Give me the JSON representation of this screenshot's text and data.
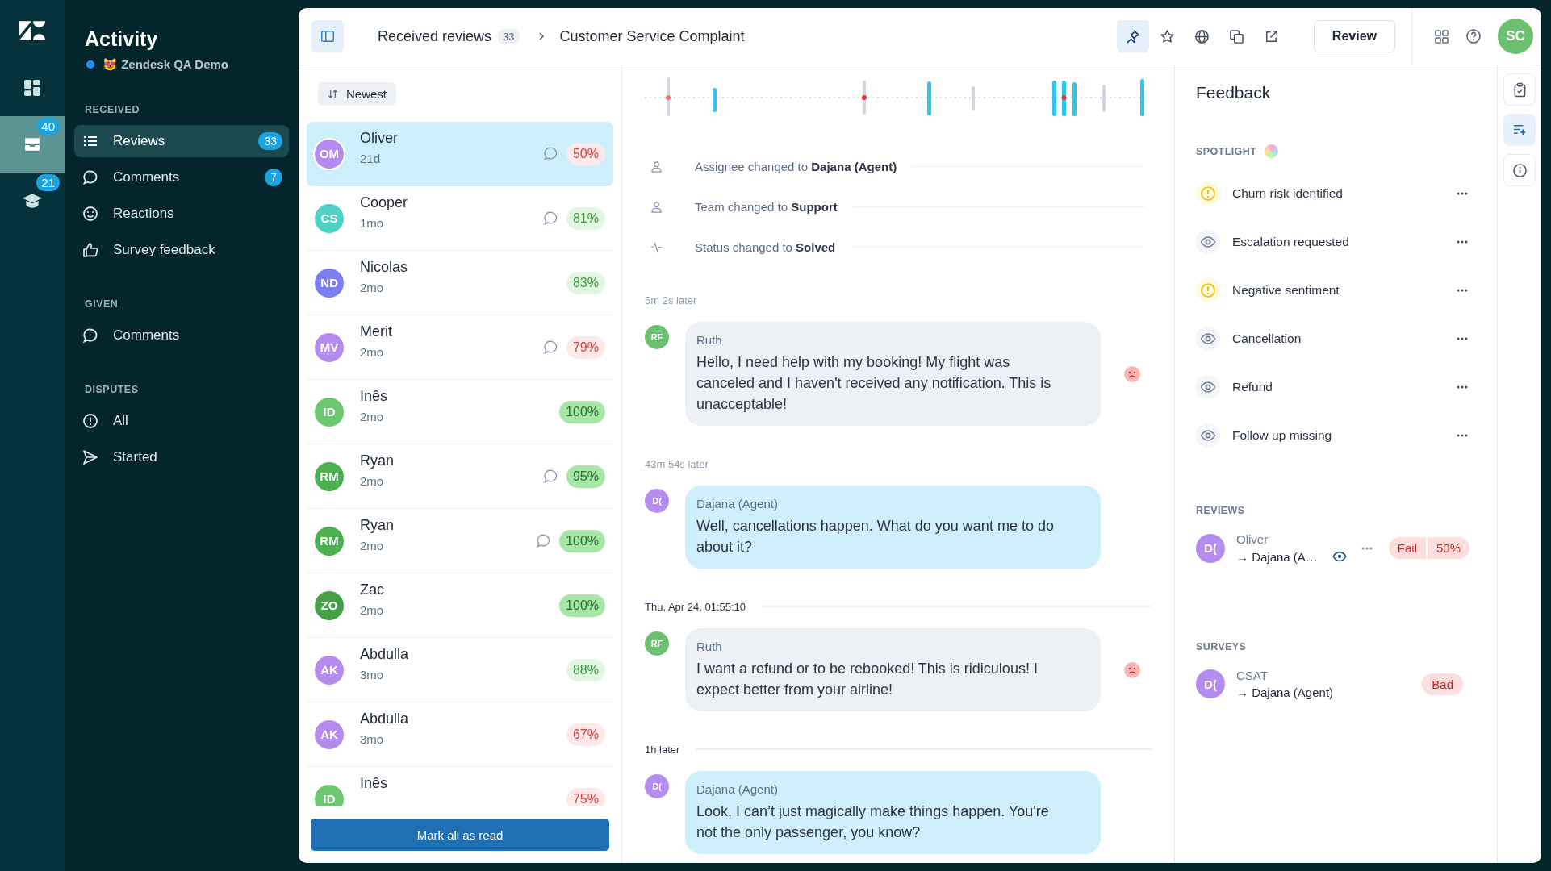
{
  "rail": [
    {
      "kind": "dashboard",
      "selected": false
    },
    {
      "kind": "inbox",
      "selected": true,
      "badge": "40"
    },
    {
      "kind": "cap",
      "selected": false,
      "badge": "21"
    }
  ],
  "sidebar": {
    "title": "Activity",
    "workspace": "😻 Zendesk QA Demo",
    "sections": [
      {
        "heading": "RECEIVED",
        "items": [
          {
            "kind": "list",
            "label": "Reviews",
            "count": "33",
            "selected": true
          },
          {
            "kind": "comment",
            "label": "Comments",
            "count": "7",
            "selected": false
          },
          {
            "kind": "smile",
            "label": "Reactions",
            "selected": false
          },
          {
            "kind": "thumb",
            "label": "Survey feedback",
            "selected": false
          }
        ]
      },
      {
        "heading": "GIVEN",
        "items": [
          {
            "kind": "comment",
            "label": "Comments",
            "selected": false
          }
        ]
      },
      {
        "heading": "DISPUTES",
        "items": [
          {
            "kind": "alert",
            "label": "All",
            "selected": false
          },
          {
            "kind": "send",
            "label": "Started",
            "selected": false
          }
        ]
      }
    ]
  },
  "header": {
    "crumb": "Received reviews",
    "crumb_count": "33",
    "title": "Customer Service Complaint",
    "actions": [
      {
        "kind": "pin",
        "selected": true
      },
      {
        "kind": "star",
        "selected": false
      },
      {
        "kind": "globe",
        "selected": false
      },
      {
        "kind": "copy",
        "selected": false
      },
      {
        "kind": "external",
        "selected": false
      }
    ],
    "review_button": "Review",
    "user_initials": "SC"
  },
  "list": {
    "sort": "Newest",
    "mark_button": "Mark all as read",
    "items": [
      {
        "initials": "OM",
        "color": "#b48cf0",
        "name": "Oliver",
        "time": "21d",
        "comment": true,
        "score": "50%",
        "passed": false,
        "top": false,
        "selected": true
      },
      {
        "initials": "CS",
        "color": "#4fd1c5",
        "name": "Cooper",
        "time": "1mo",
        "comment": true,
        "score": "81%",
        "passed": true,
        "top": false,
        "selected": false
      },
      {
        "initials": "ND",
        "color": "#7a7ef0",
        "name": "Nicolas",
        "time": "2mo",
        "comment": false,
        "score": "83%",
        "passed": true,
        "top": false,
        "selected": false
      },
      {
        "initials": "MV",
        "color": "#b48cf0",
        "name": "Merit",
        "time": "2mo",
        "comment": true,
        "score": "79%",
        "passed": false,
        "top": false,
        "selected": false
      },
      {
        "initials": "ID",
        "color": "#6cc870",
        "name": "Inês",
        "time": "2mo",
        "comment": false,
        "score": "100%",
        "passed": true,
        "top": true,
        "selected": false
      },
      {
        "initials": "RM",
        "color": "#4caf50",
        "name": "Ryan",
        "time": "2mo",
        "comment": true,
        "score": "95%",
        "passed": true,
        "top": true,
        "selected": false
      },
      {
        "initials": "RM",
        "color": "#4caf50",
        "name": "Ryan",
        "time": "2mo",
        "comment": true,
        "score": "100%",
        "passed": true,
        "top": true,
        "selected": false
      },
      {
        "initials": "ZO",
        "color": "#43a047",
        "name": "Zac",
        "time": "2mo",
        "comment": false,
        "score": "100%",
        "passed": true,
        "top": true,
        "selected": false
      },
      {
        "initials": "AK",
        "color": "#b48cf0",
        "name": "Abdulla",
        "time": "3mo",
        "comment": false,
        "score": "88%",
        "passed": true,
        "top": false,
        "selected": false
      },
      {
        "initials": "AK",
        "color": "#b48cf0",
        "name": "Abdulla",
        "time": "3mo",
        "comment": false,
        "score": "67%",
        "passed": false,
        "top": false,
        "selected": false
      },
      {
        "initials": "ID",
        "color": "#6cc870",
        "name": "Inês",
        "comment": false,
        "score": "75%",
        "passed": false,
        "top": false,
        "selected": false
      }
    ]
  },
  "events": [
    {
      "kind": "person",
      "text": "Assignee changed to **Dajana (Agent)**"
    },
    {
      "kind": "person",
      "text": "Team changed to **Support**"
    },
    {
      "kind": "activity",
      "text": "Status changed to **Solved**"
    }
  ],
  "thread": [
    {
      "kind": "gap",
      "label": "5m 2s later",
      "ruled": false
    },
    {
      "kind": "message",
      "from_agent": false,
      "initials": "RF",
      "color": "#6cc070",
      "author": "Ruth",
      "text": "Hello, I need help with my booking! My flight was canceled and I haven't received any notification. This is unacceptable!",
      "negative": true
    },
    {
      "kind": "gap",
      "label": "43m 54s later",
      "ruled": false
    },
    {
      "kind": "message",
      "from_agent": true,
      "initials": "D(",
      "color": "#b58cf0",
      "author": "Dajana (Agent)",
      "text": "Well, cancellations happen. What do you want me to do about it?",
      "negative": false
    },
    {
      "kind": "gap",
      "label": "Thu, Apr 24, 01:55:10",
      "ruled": true
    },
    {
      "kind": "message",
      "from_agent": false,
      "initials": "RF",
      "color": "#6cc070",
      "author": "Ruth",
      "text": "I want a refund or to be rebooked! This is ridiculous! I expect better from your airline!",
      "negative": true
    },
    {
      "kind": "gap",
      "label": "1h later",
      "ruled": true
    },
    {
      "kind": "message",
      "from_agent": true,
      "initials": "D(",
      "color": "#b58cf0",
      "author": "Dajana (Agent)",
      "text": "Look, I can’t just magically make things happen. You're not the only passenger, you know?",
      "negative": false
    }
  ],
  "feedback": {
    "title": "Feedback",
    "spotlight_heading": "SPOTLIGHT",
    "spotlight": [
      {
        "kind": "alert",
        "label": "Churn risk identified"
      },
      {
        "kind": "eye",
        "label": "Escalation requested"
      },
      {
        "kind": "alert",
        "label": "Negative sentiment"
      },
      {
        "kind": "eye",
        "label": "Cancellation"
      },
      {
        "kind": "eye",
        "label": "Refund"
      },
      {
        "kind": "eye",
        "label": "Follow up missing"
      }
    ],
    "reviews_heading": "REVIEWS",
    "review": {
      "initials": "D(",
      "color": "#b58cf0",
      "reviewer": "Oliver",
      "reviewee": "→ Dajana (A…",
      "result": "Fail",
      "score": "50%"
    },
    "surveys_heading": "SURVEYS",
    "survey": {
      "initials": "D(",
      "color": "#b58cf0",
      "name": "CSAT",
      "reviewee": "→ Dajana (Agent)",
      "result": "Bad"
    }
  },
  "side_tools": [
    {
      "kind": "clipboard",
      "selected": false
    },
    {
      "kind": "sparkle",
      "selected": true
    },
    {
      "kind": "info",
      "selected": false
    }
  ]
}
